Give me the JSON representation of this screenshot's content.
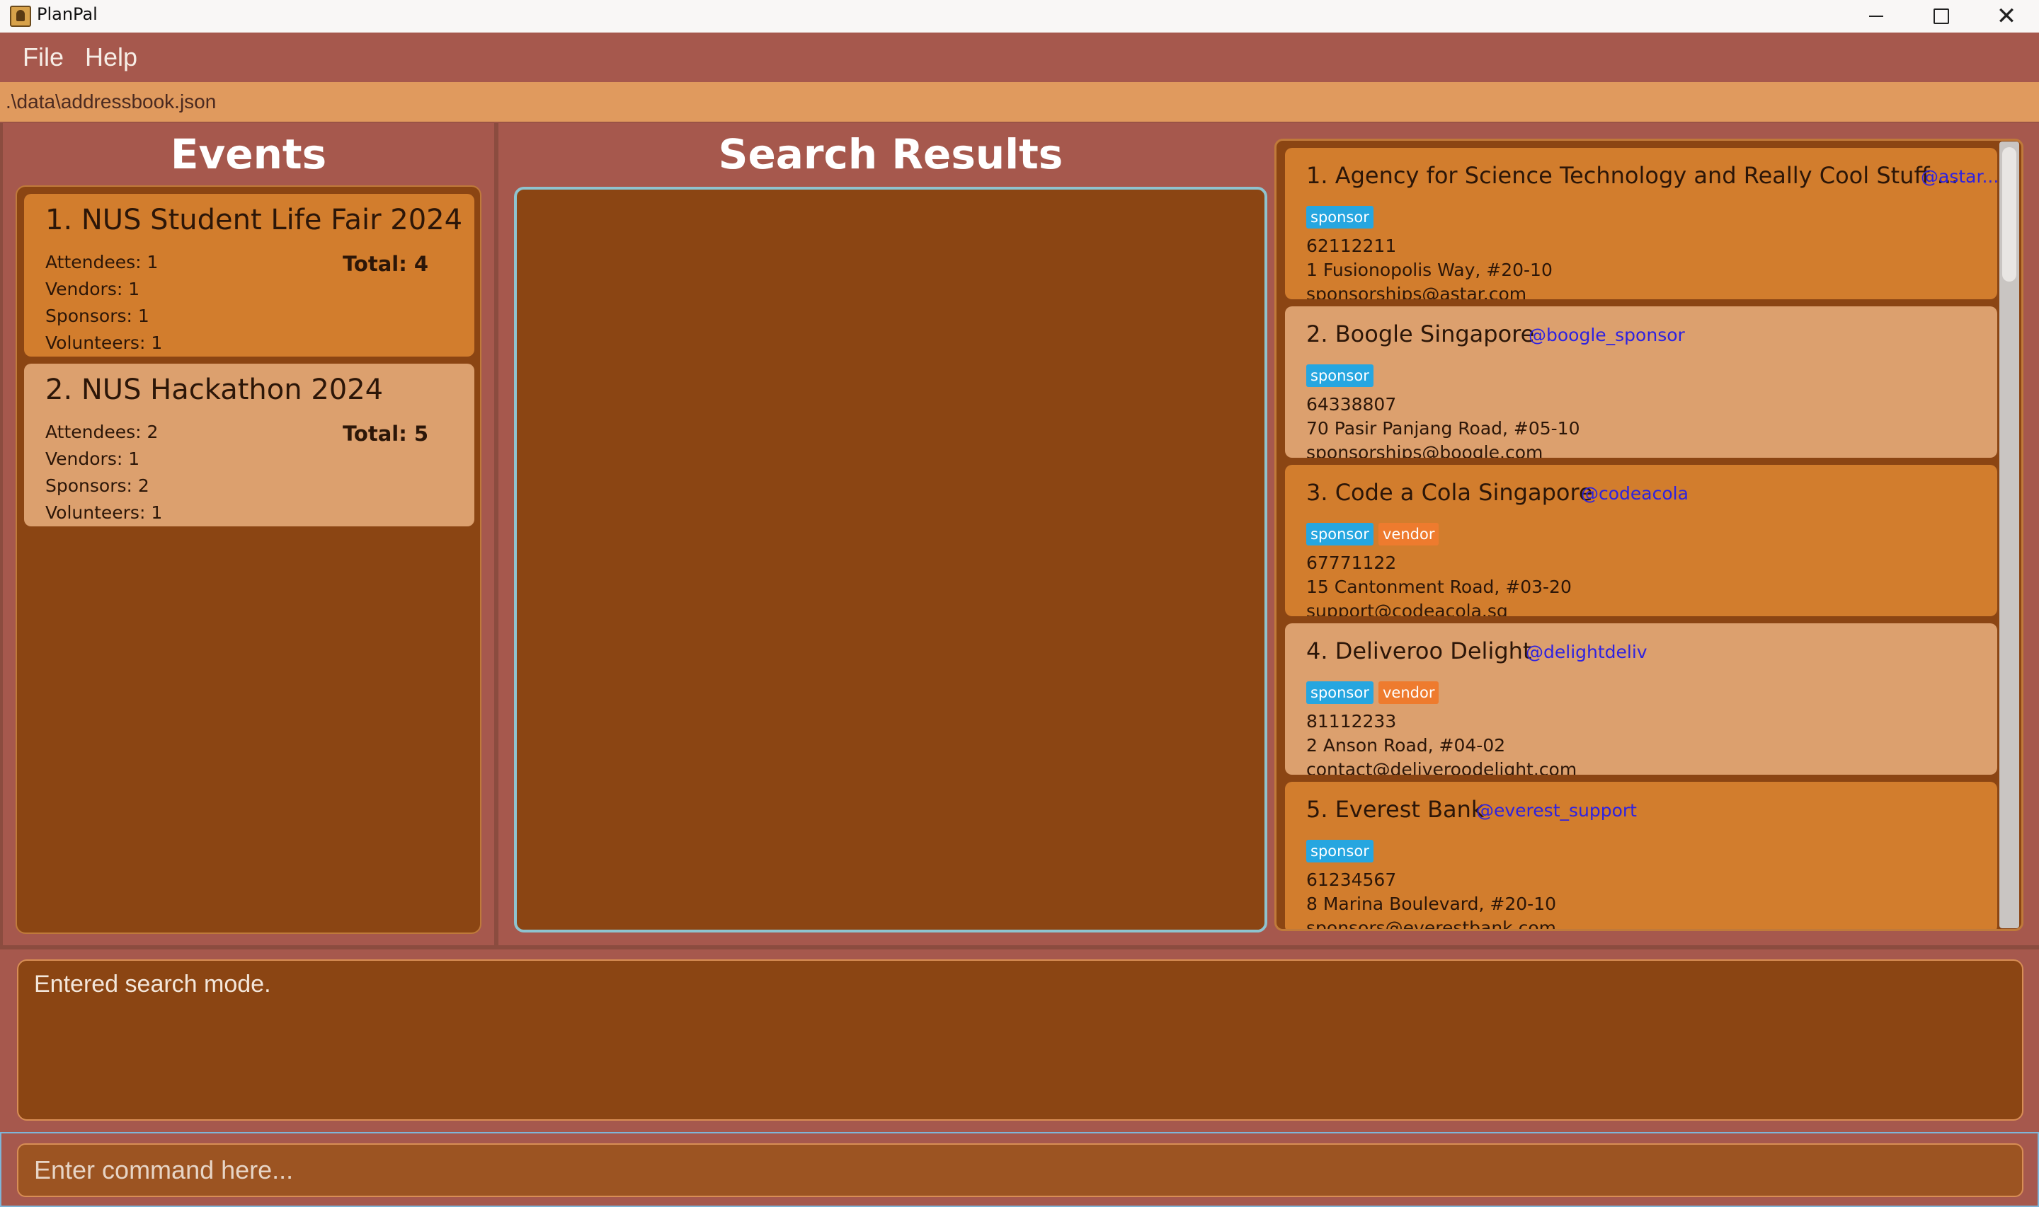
{
  "window": {
    "title": "PlanPal"
  },
  "menu": [
    "File",
    "Help"
  ],
  "path": ".\\data\\addressbook.json",
  "events_title": "Events",
  "search_title": "Search Results",
  "events": [
    {
      "title": "1. NUS Student Life Fair 2024",
      "attendees": "Attendees: 1",
      "vendors": "Vendors: 1",
      "sponsors": "Sponsors: 1",
      "volunteers": "Volunteers: 1",
      "total": "Total: 4",
      "selected": true
    },
    {
      "title": "2. NUS Hackathon 2024",
      "attendees": "Attendees: 2",
      "vendors": "Vendors: 1",
      "sponsors": "Sponsors: 2",
      "volunteers": "Volunteers: 1",
      "total": "Total: 5",
      "selected": false
    }
  ],
  "contacts": [
    {
      "title": "1. Agency for Science Technology and Really Cool Stuff ...",
      "handle": "@astar...",
      "tags": [
        "sponsor"
      ],
      "phone": "62112211",
      "address": "1 Fusionopolis Way, #20-10",
      "email": "sponsorships@astar.com"
    },
    {
      "title": "2. Boogle Singapore",
      "handle": "@boogle_sponsor",
      "tags": [
        "sponsor"
      ],
      "phone": "64338807",
      "address": "70 Pasir Panjang Road, #05-10",
      "email": "sponsorships@boogle.com"
    },
    {
      "title": "3. Code a Cola Singapore",
      "handle": "@codeacola",
      "tags": [
        "sponsor",
        "vendor"
      ],
      "phone": "67771122",
      "address": "15 Cantonment Road, #03-20",
      "email": "support@codeacola.sg"
    },
    {
      "title": "4. Deliveroo Delight",
      "handle": "@delightdeliv",
      "tags": [
        "sponsor",
        "vendor"
      ],
      "phone": "81112233",
      "address": "2 Anson Road, #04-02",
      "email": "contact@deliveroodelight.com"
    },
    {
      "title": "5. Everest Bank",
      "handle": "@everest_support",
      "tags": [
        "sponsor"
      ],
      "phone": "61234567",
      "address": "8 Marina Boulevard, #20-10",
      "email": "sponsors@everestbank.com"
    }
  ],
  "result_message": "Entered search mode.",
  "command": {
    "placeholder": "Enter command here...",
    "value": ""
  },
  "colors": {
    "bg": "#A6584D",
    "panel": "#8B4513",
    "card_selected": "#D27D2D",
    "card": "#DCA06E",
    "path_bar": "#E09A5E",
    "handle": "#2E22E0",
    "tag_sponsor": "#26A6E0",
    "tag_vendor": "#EE7B2E",
    "focus": "#8EC3CF"
  },
  "icons": [
    "app-icon",
    "minimize-icon",
    "maximize-icon",
    "close-icon"
  ]
}
